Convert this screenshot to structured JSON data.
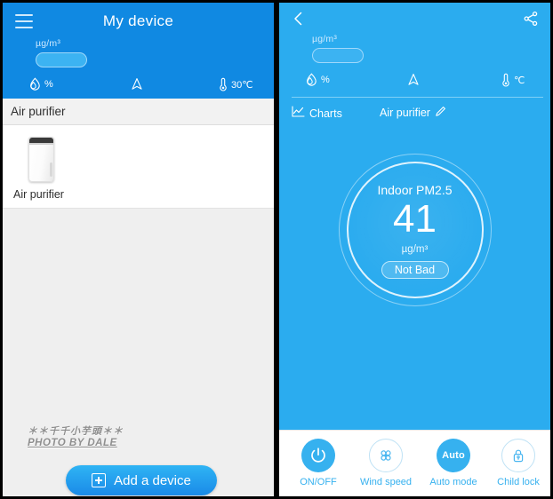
{
  "left": {
    "header": {
      "menu_icon": "hamburger-menu-icon",
      "title": "My device",
      "pm_unit": "µg/m³",
      "pm_value_placeholder": "",
      "metrics": [
        {
          "icon": "humidity-droplet-icon",
          "value": "%"
        },
        {
          "icon": "air-quality-arrow-icon",
          "value": ""
        },
        {
          "icon": "thermometer-icon",
          "value": "30℃"
        }
      ]
    },
    "section_header": "Air purifier",
    "device": {
      "icon": "air-purifier-device-icon",
      "name": "Air purifier"
    },
    "watermark": {
      "line1": "＊＊千千小芋頭＊＊",
      "line2": "PHOTO BY DALE"
    },
    "add_device": {
      "icon": "plus-box-icon",
      "label": "Add a device"
    }
  },
  "right": {
    "header": {
      "back_icon": "back-chevron-icon",
      "share_icon": "share-icon",
      "pm_unit": "µg/m³",
      "pm_value_placeholder": "",
      "metrics": [
        {
          "icon": "humidity-droplet-icon",
          "value": "%"
        },
        {
          "icon": "air-quality-arrow-icon",
          "value": ""
        },
        {
          "icon": "thermometer-icon",
          "value": "℃"
        }
      ]
    },
    "toolbar": {
      "charts_icon": "line-chart-icon",
      "charts_label": "Charts",
      "device_name": "Air purifier",
      "edit_icon": "pencil-edit-icon"
    },
    "gauge": {
      "label": "Indoor PM2.5",
      "value": "41",
      "unit": "µg/m³",
      "status": "Not Bad"
    },
    "controls": [
      {
        "icon": "power-icon",
        "label": "ON/OFF",
        "state": "filled"
      },
      {
        "icon": "fan-icon",
        "label": "Wind speed",
        "state": "outlined"
      },
      {
        "icon": "auto-text-icon",
        "label": "Auto mode",
        "state": "filled",
        "text": "Auto"
      },
      {
        "icon": "padlock-icon",
        "label": "Child lock",
        "state": "outlined"
      }
    ]
  },
  "colors": {
    "left_header_blue": "#1089e2",
    "panel_blue": "#2bacef",
    "accent_blue": "#36b1ef",
    "page_gray": "#efefef",
    "section_gray": "#f2f2f2"
  }
}
